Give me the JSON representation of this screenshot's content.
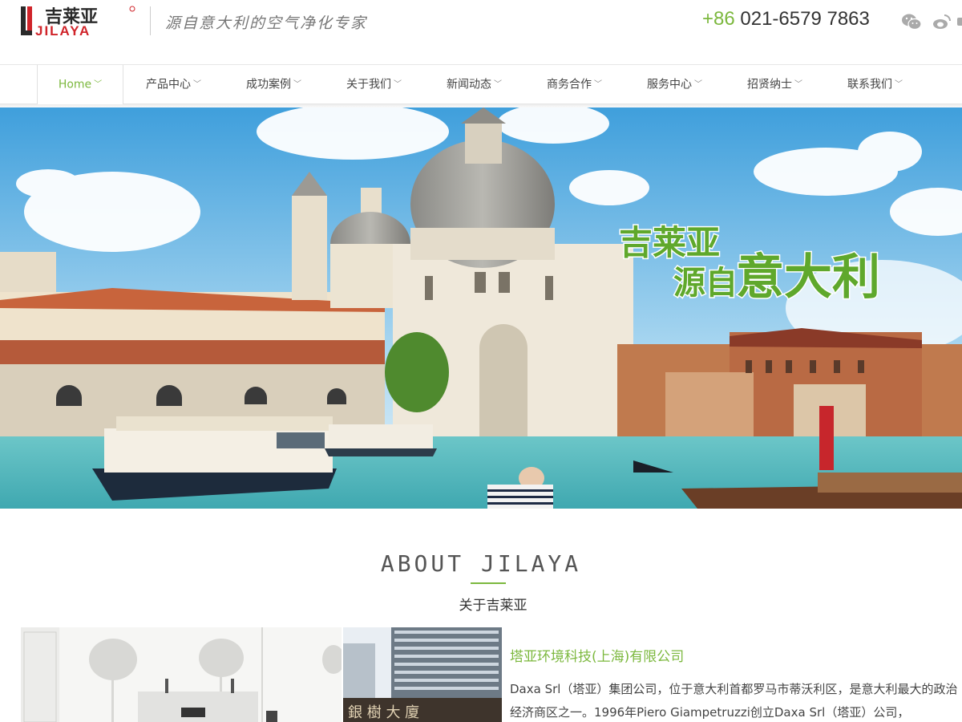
{
  "header": {
    "logo_cn": "吉莱亚",
    "logo_en": "JILAYA",
    "slogan": "源自意大利的空气净化专家",
    "phone_cc": "+86",
    "phone_number": "021-6579 7863"
  },
  "nav": {
    "items": [
      {
        "label": "Home"
      },
      {
        "label": "产品中心"
      },
      {
        "label": "成功案例"
      },
      {
        "label": "关于我们"
      },
      {
        "label": "新闻动态"
      },
      {
        "label": "商务合作"
      },
      {
        "label": "服务中心"
      },
      {
        "label": "招贤纳士"
      },
      {
        "label": "联系我们"
      }
    ],
    "caret": "﹀"
  },
  "banner": {
    "line1": "吉莱亚",
    "line2_a": "源自",
    "line2_b": "意大利"
  },
  "about": {
    "title": "ABOUT JILAYA",
    "subtitle": "关于吉莱亚",
    "company_name": "塔亚环境科技(上海)有限公司",
    "description": "Daxa Srl（塔亚）集团公司，位于意大利首都罗马市蒂沃利区，是意大利最大的政治经济商区之一。1996年Piero Giampetruzzi创立Daxa Srl（塔亚）公司，",
    "building_sign": "銀 樹 大 廈"
  },
  "colors": {
    "accent": "#7cb83e",
    "logo_red": "#d0242a",
    "logo_dark": "#2a2a2a"
  }
}
